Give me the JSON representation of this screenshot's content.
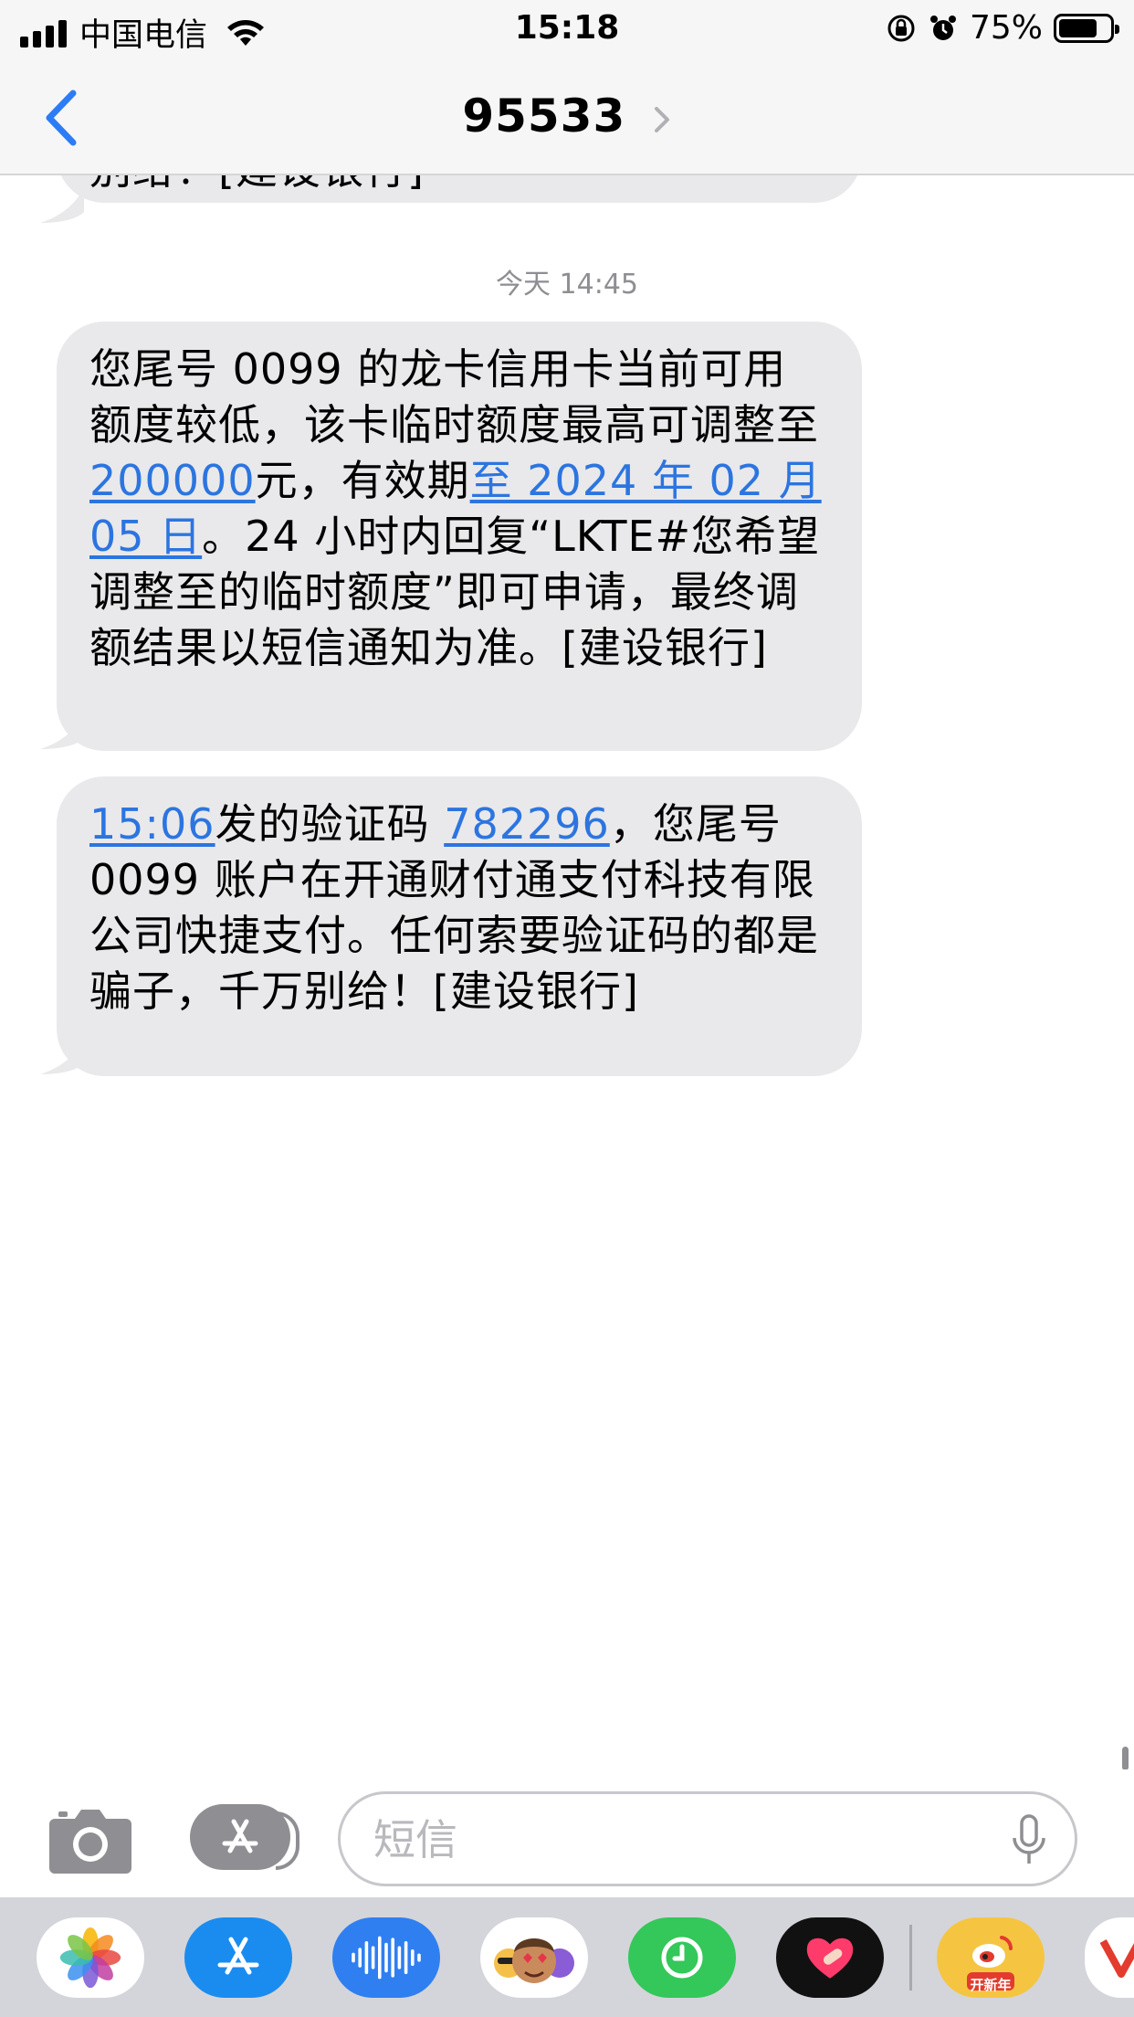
{
  "status_bar": {
    "carrier": "中国电信",
    "time": "15:18",
    "battery": "75%",
    "battery_level": 0.75
  },
  "nav": {
    "title": "95533"
  },
  "conversation": {
    "previous_fragment": "别给！[建设银行]",
    "timestamp": "今天 14:45",
    "messages": [
      {
        "parts": [
          "您尾号 0099 的龙卡信用卡当前可用额度较低，该卡临时额度最高可调整至 ",
          "200000",
          "元，有效期",
          "至 2024 年 02 月 05 日",
          "。24 小时内回复“LKTE#您希望调整至的临时额度”即可申请，最终调额结果以短信通知为准。[建设银行]"
        ]
      },
      {
        "parts": [
          "15:06",
          "发的验证码 ",
          "782296",
          "，您尾号 0099 账户在开通财付通支付科技有限公司快捷支付。任何索要验证码的都是骗子，千万别给！[建设银行]"
        ]
      }
    ]
  },
  "input": {
    "placeholder": "短信"
  },
  "app_drawer": {
    "apps": [
      {
        "icon": "photos-icon",
        "color": "#ffffff"
      },
      {
        "icon": "app-store-icon",
        "color": "#1a8cf0"
      },
      {
        "icon": "audio-message-icon",
        "color": "#2f7ff1"
      },
      {
        "icon": "memoji-icon",
        "color": "#ffffff"
      },
      {
        "icon": "digital-touch-icon",
        "color": "#34c759"
      },
      {
        "icon": "heart-sticker-icon",
        "color": "#111111"
      },
      {
        "icon": "weibo-icon",
        "color": "#f5c542"
      },
      {
        "icon": "v-app-icon",
        "color": "#ffffff"
      }
    ],
    "weibo_badge": "开新年"
  },
  "colors": {
    "link": "#2c75e0",
    "bubble": "#e9e9eb",
    "accent": "#2c7cf6"
  }
}
